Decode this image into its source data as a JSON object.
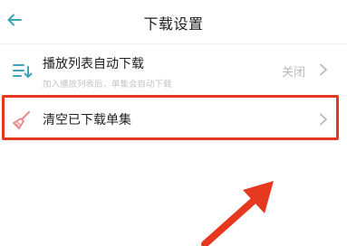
{
  "header": {
    "title": "下载设置",
    "back_icon": "back-arrow-icon"
  },
  "settings": {
    "auto_download": {
      "icon": "playlist-download-icon",
      "label": "播放列表自动下载",
      "sublabel": "加入播放列表后，单集会自动下载",
      "value": "关闭"
    },
    "clear_downloads": {
      "icon": "broom-icon",
      "label": "清空已下载单集"
    }
  },
  "colors": {
    "accent": "#3aa5ba",
    "highlight": "#e5391f",
    "broom": "#e48a8a"
  }
}
